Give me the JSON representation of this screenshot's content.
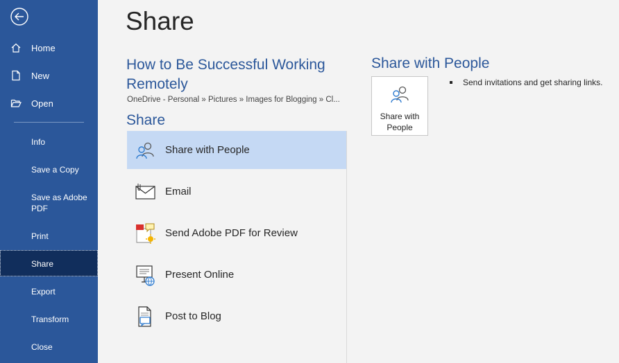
{
  "sidebar": {
    "top_items": [
      {
        "label": "Home",
        "icon": "home-icon"
      },
      {
        "label": "New",
        "icon": "new-document-icon"
      },
      {
        "label": "Open",
        "icon": "open-folder-icon"
      }
    ],
    "items": [
      {
        "label": "Info"
      },
      {
        "label": "Save a Copy"
      },
      {
        "label": "Save as Adobe PDF"
      },
      {
        "label": "Print"
      },
      {
        "label": "Share",
        "selected": true
      },
      {
        "label": "Export"
      },
      {
        "label": "Transform"
      },
      {
        "label": "Close"
      }
    ]
  },
  "main": {
    "title": "Share",
    "document_title": "How to Be Successful Working Remotely",
    "document_path": "OneDrive - Personal » Pictures » Images for Blogging » Cl...",
    "section_heading": "Share",
    "options": [
      {
        "label": "Share with People",
        "icon": "share-people-icon",
        "selected": true
      },
      {
        "label": "Email",
        "icon": "email-icon"
      },
      {
        "label": "Send Adobe PDF for Review",
        "icon": "adobe-review-icon"
      },
      {
        "label": "Present Online",
        "icon": "present-online-icon"
      },
      {
        "label": "Post to Blog",
        "icon": "blog-icon"
      }
    ]
  },
  "detail": {
    "heading": "Share with People",
    "tile_label": "Share with People",
    "bullet": "Send invitations and get sharing links."
  },
  "colors": {
    "sidebar_bg": "#2b579a",
    "sidebar_selected": "#112e5c",
    "accent_text": "#2b579a",
    "option_selected": "#c5d9f4"
  }
}
